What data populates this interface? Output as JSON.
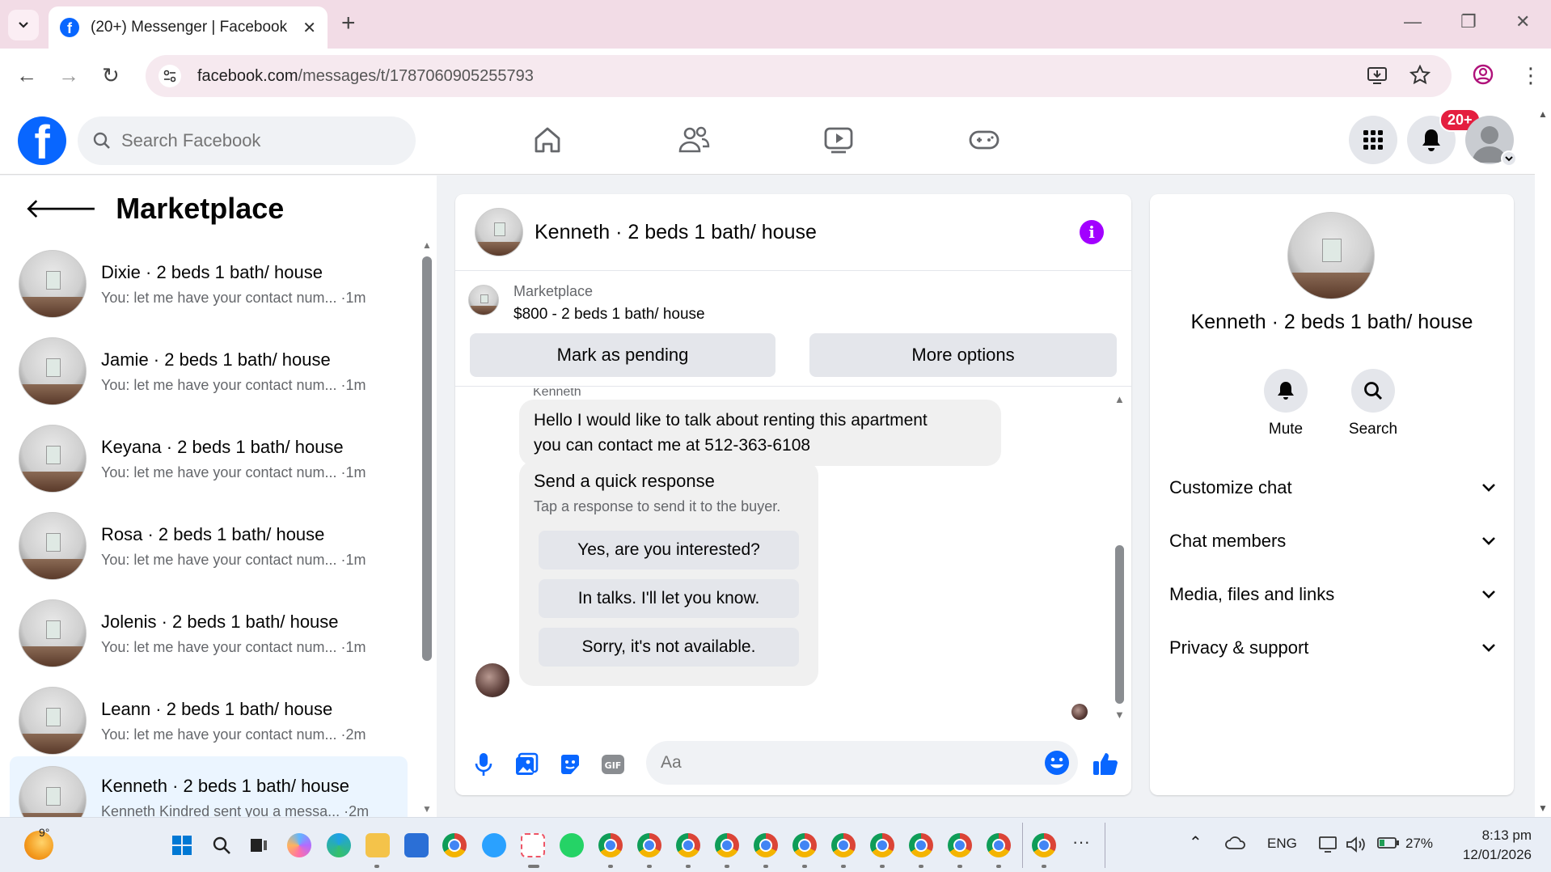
{
  "browser": {
    "tab_title": "(20+) Messenger | Facebook",
    "url_domain": "facebook.com",
    "url_path": "/messages/t/1787060905255793"
  },
  "fb": {
    "search_placeholder": "Search Facebook",
    "notification_badge": "20+"
  },
  "sidebar": {
    "title": "Marketplace",
    "conversations": [
      {
        "name": "Dixie · 2 beds 1 bath/ house",
        "preview": "You: let me have your contact num... ·1m",
        "active": false
      },
      {
        "name": "Jamie · 2 beds 1 bath/ house",
        "preview": "You: let me have your contact num... ·1m",
        "active": false
      },
      {
        "name": "Keyana · 2 beds 1 bath/ house",
        "preview": "You: let me have your contact num... ·1m",
        "active": false
      },
      {
        "name": "Rosa · 2 beds 1 bath/ house",
        "preview": "You: let me have your contact num... ·1m",
        "active": false
      },
      {
        "name": "Jolenis · 2 beds 1 bath/ house",
        "preview": "You: let me have your contact num... ·1m",
        "active": false
      },
      {
        "name": "Leann · 2 beds 1 bath/ house",
        "preview": "You: let me have your contact num... ·2m",
        "active": false
      },
      {
        "name": "Kenneth · 2 beds 1 bath/ house",
        "preview": "Kenneth Kindred sent you a messa... ·2m",
        "active": true
      }
    ]
  },
  "chat": {
    "title": "Kenneth · 2 beds 1 bath/ house",
    "marketplace_label": "Marketplace",
    "listing": "$800 - 2 beds 1 bath/ house",
    "mark_pending": "Mark as pending",
    "more_options": "More options",
    "sender": "Kenneth",
    "message_line1": "Hello I would like to talk about renting this apartment",
    "message_line2": "you can contact me at 512-363-6108",
    "quick_title": "Send a quick response",
    "quick_subtitle": "Tap a response to send it to the buyer.",
    "quick_options": [
      "Yes, are you interested?",
      "In talks. I'll let you know.",
      "Sorry, it's not available."
    ],
    "input_placeholder": "Aa"
  },
  "details": {
    "name": "Kenneth · 2 beds 1 bath/ house",
    "mute": "Mute",
    "search": "Search",
    "sections": [
      "Customize chat",
      "Chat members",
      "Media, files and links",
      "Privacy & support"
    ]
  },
  "taskbar": {
    "weather": "9°",
    "language": "ENG",
    "battery": "27%",
    "time": "8:13 pm",
    "date": "12/01/2026"
  },
  "colors": {
    "fb_blue": "#0866ff",
    "info_purple": "#a200ff",
    "badge_red": "#e41e3f",
    "active_row": "#ebf5ff",
    "tab_strip": "#f2dce6"
  }
}
